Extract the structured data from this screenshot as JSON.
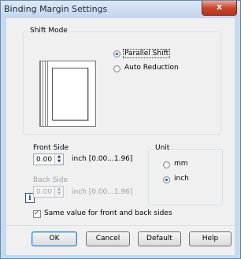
{
  "window": {
    "title": "Binding Margin Settings",
    "close_symbol": "x"
  },
  "shift_mode": {
    "legend": "Shift Mode",
    "options": [
      {
        "label": "Parallel Shift",
        "selected": true
      },
      {
        "label": "Auto Reduction",
        "selected": false
      }
    ]
  },
  "front_side": {
    "label": "Front Side",
    "value": "0.00",
    "range": "inch [0.00...1.96]"
  },
  "back_side": {
    "label": "Back Side",
    "value": "0.00",
    "range": "inch [0.00...1.96]",
    "disabled": true
  },
  "unit": {
    "legend": "Unit",
    "options": [
      {
        "label": "mm",
        "selected": false
      },
      {
        "label": "inch",
        "selected": true
      }
    ]
  },
  "same_value": {
    "label": "Same value for front and back sides",
    "checked": true
  },
  "info_icon": {
    "glyph": "i"
  },
  "buttons": {
    "ok": "OK",
    "cancel": "Cancel",
    "default": "Default",
    "help": "Help"
  },
  "colors": {
    "title_bar": "#c6d9ef",
    "close_button": "#c9462c",
    "selection": "#1a5fb4"
  }
}
